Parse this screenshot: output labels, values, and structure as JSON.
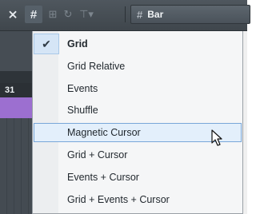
{
  "toolbar": {
    "snap_icon": "snap-toggle-icon",
    "grid_icon": "grid-icon",
    "grid_type_label": "Bar",
    "grid_type_icon": "grid-icon"
  },
  "ruler": {
    "bar_number": "31"
  },
  "menu": {
    "items": [
      {
        "label": "Grid",
        "checked": true
      },
      {
        "label": "Grid Relative"
      },
      {
        "label": "Events"
      },
      {
        "label": "Shuffle"
      },
      {
        "label": "Magnetic Cursor",
        "hovered": true
      },
      {
        "label": "Grid + Cursor"
      },
      {
        "label": "Events + Cursor"
      },
      {
        "label": "Grid + Events + Cursor"
      }
    ],
    "check_glyph": "✔"
  },
  "colors": {
    "toolbar_bg": "#4a5258",
    "event_purple": "#9c6fd0",
    "hover_border": "#79a7d8",
    "hover_bg": "#e3effb"
  }
}
